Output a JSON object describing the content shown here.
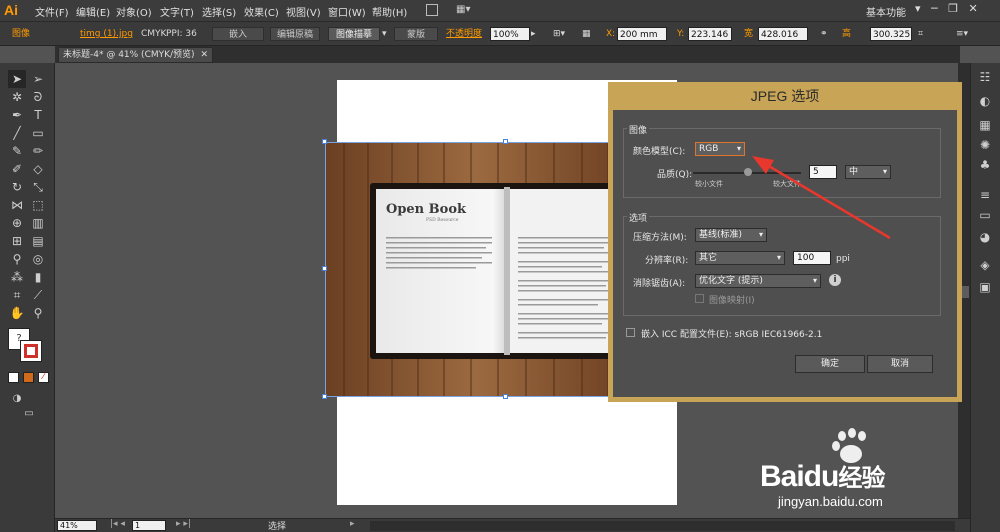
{
  "app": {
    "logo": "Ai",
    "workspace": "基本功能"
  },
  "menu": [
    "文件(F)",
    "编辑(E)",
    "对象(O)",
    "文字(T)",
    "选择(S)",
    "效果(C)",
    "视图(V)",
    "窗口(W)",
    "帮助(H)"
  ],
  "control": {
    "object_type": "图像",
    "file_link": "timg (1).jpg",
    "color_mode": "CMYK",
    "ppi": "PPI: 36",
    "embed": "嵌入",
    "edit_original": "编辑原稿",
    "image_trace": "图像描摹",
    "mask": "蒙版",
    "opacity_label": "不透明度",
    "opacity_value": "100%",
    "x_label": "X:",
    "x_value": "200 mm",
    "y_label": "Y:",
    "y_value": "223.146",
    "w_label": "宽",
    "w_value": "428.016",
    "h_label": "高",
    "h_value": "300.325"
  },
  "document": {
    "tab": "未标题-4* @ 41% (CMYK/预览)"
  },
  "artwork": {
    "book_title": "Open Book",
    "book_subtitle": "PSD Resource"
  },
  "status": {
    "zoom": "41%",
    "page": "1",
    "tool": "选择"
  },
  "dialog": {
    "title": "JPEG 选项",
    "image_group": "图像",
    "color_model_label": "颜色模型(C):",
    "color_model_value": "RGB",
    "quality_label": "品质(Q):",
    "quality_min": "较小文件",
    "quality_max": "较大文件",
    "quality_value": "5",
    "quality_preset": "中",
    "options_group": "选项",
    "compression_label": "压缩方法(M):",
    "compression_value": "基线(标准)",
    "resolution_label": "分辨率(R):",
    "resolution_value": "其它",
    "resolution_number": "100",
    "resolution_unit": "ppi",
    "antialias_label": "消除锯齿(A):",
    "antialias_value": "优化文字 (提示)",
    "image_map": "图像映射(I)",
    "embed_icc": "嵌入 ICC 配置文件(E): sRGB IEC61966-2.1",
    "ok": "确定",
    "cancel": "取消"
  },
  "watermark": {
    "brand": "Baidu",
    "brand_cn": "经验",
    "url": "jingyan.baidu.com"
  },
  "colors": {
    "ai_orange": "#ff9a00",
    "dialog_frame": "#c8a456",
    "arrow": "#e8372c"
  }
}
